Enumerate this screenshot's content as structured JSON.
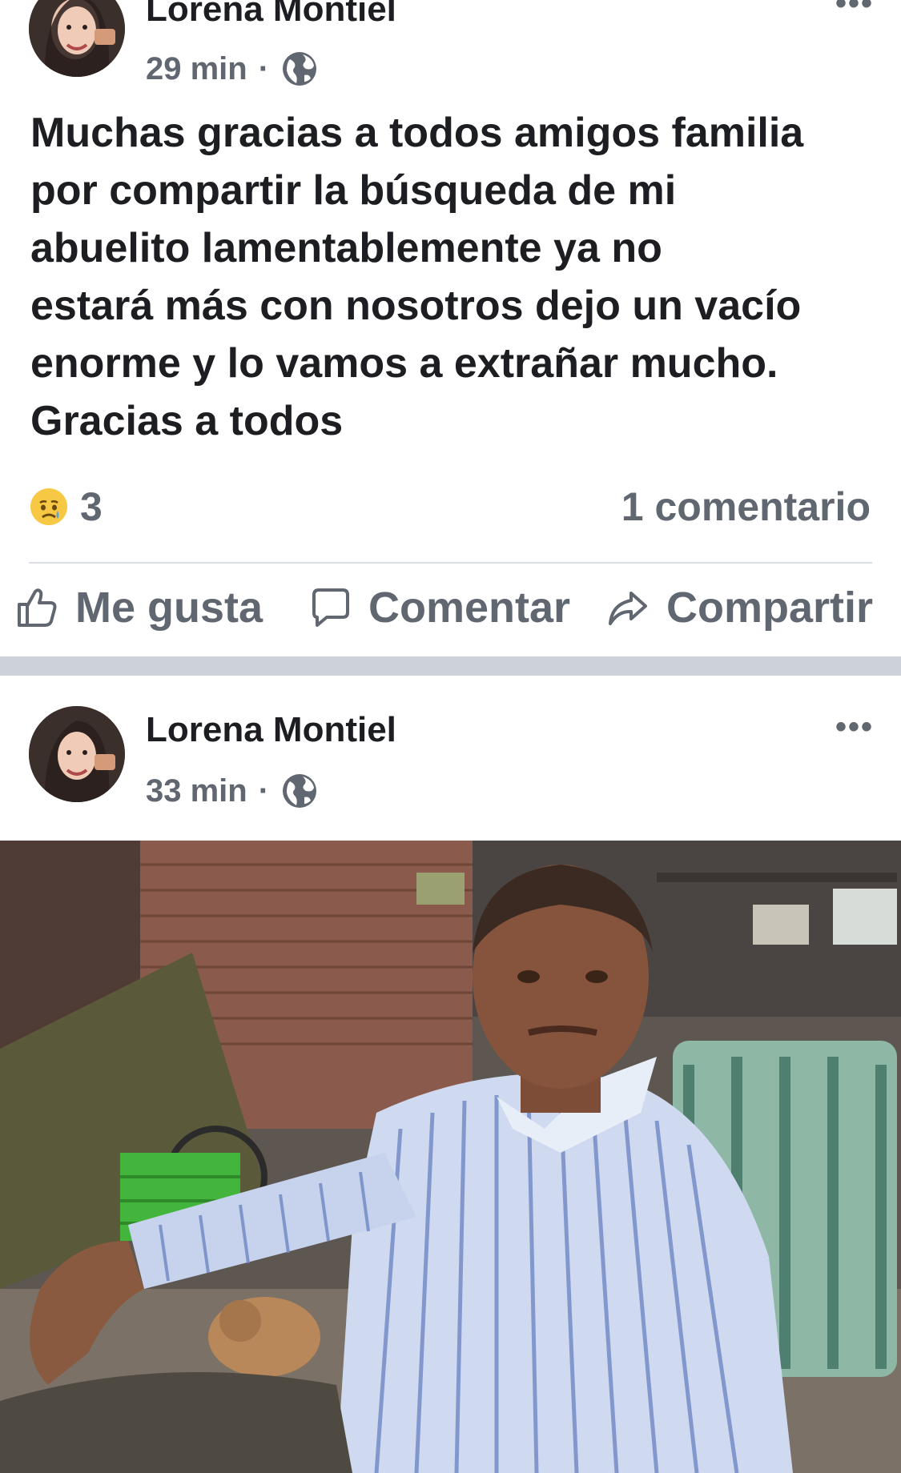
{
  "posts": [
    {
      "author": "Lorena Montiel",
      "time": "29 min",
      "separator": "·",
      "privacy_icon": "globe-icon",
      "more_label": "•••",
      "text": "Muchas gracias a todos amigos familia\npor compartir la búsqueda de mi\nabuelito lamentablemente ya no\nestará más con nosotros dejo un vacío\nenorme y lo vamos a extrañar mucho.\nGracias a todos",
      "reaction_icon": "sad-emoji-icon",
      "reaction_count": "3",
      "comment_count": "1 comentario",
      "actions": {
        "like": "Me gusta",
        "comment": "Comentar",
        "share": "Compartir"
      }
    },
    {
      "author": "Lorena Montiel",
      "time": "33 min",
      "separator": "·",
      "privacy_icon": "globe-icon",
      "more_label": "•••",
      "photo": "elderly-man-in-striped-shirt-photo"
    }
  ],
  "colors": {
    "text_primary": "#1c1e21",
    "text_secondary": "#606770",
    "divider_band": "#cdd2d9",
    "rule": "#dadde1"
  }
}
